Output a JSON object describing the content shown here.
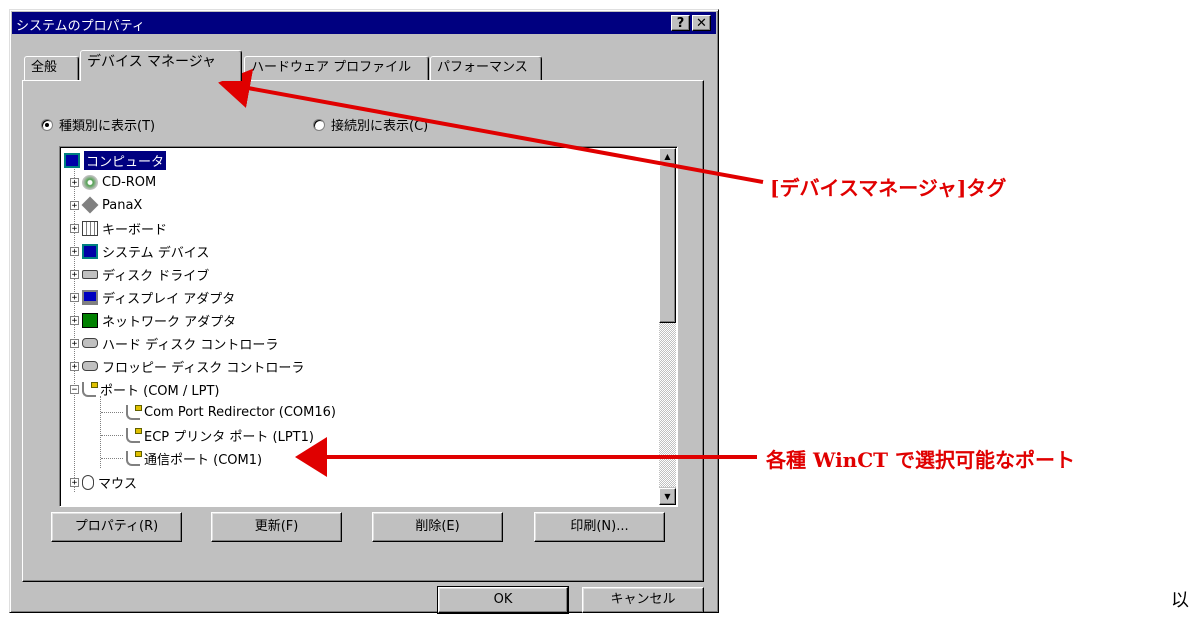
{
  "window": {
    "title": "システムのプロパティ",
    "help_label": "?",
    "close_label": "✕"
  },
  "tabs": [
    "全般",
    "デバイス マネージャ",
    "ハードウェア プロファイル",
    "パフォーマンス"
  ],
  "active_tab": "デバイス マネージャ",
  "view_options": {
    "by_type": "種類別に表示(T)",
    "by_connection": "接続別に表示(C)",
    "selected": "by_type"
  },
  "tree": {
    "root": "コンピュータ",
    "items": [
      {
        "label": "CD-ROM",
        "icon": "cd-icon",
        "expander": "+"
      },
      {
        "label": "PanaX",
        "icon": "diamond-icon",
        "expander": "+"
      },
      {
        "label": "キーボード",
        "icon": "keyboard-icon",
        "expander": "+"
      },
      {
        "label": "システム デバイス",
        "icon": "computer-icon",
        "expander": "+"
      },
      {
        "label": "ディスク ドライブ",
        "icon": "disk-drive-icon",
        "expander": "+"
      },
      {
        "label": "ディスプレイ アダプタ",
        "icon": "monitor-icon",
        "expander": "+"
      },
      {
        "label": "ネットワーク アダプタ",
        "icon": "network-card-icon",
        "expander": "+"
      },
      {
        "label": "ハード ディスク コントローラ",
        "icon": "hdd-controller-icon",
        "expander": "+"
      },
      {
        "label": "フロッピー ディスク コントローラ",
        "icon": "floppy-controller-icon",
        "expander": "+"
      },
      {
        "label": "ポート (COM / LPT)",
        "icon": "port-icon",
        "expander": "−"
      }
    ],
    "ports": [
      "Com Port Redirector (COM16)",
      "ECP プリンタ ポート (LPT1)",
      "通信ポート (COM1)"
    ],
    "last": {
      "label": "マウス",
      "icon": "mouse-icon",
      "expander": "+"
    }
  },
  "buttons": {
    "properties": "プロパティ(R)",
    "refresh": "更新(F)",
    "remove": "削除(E)",
    "print": "印刷(N)...",
    "ok": "OK",
    "cancel": "キャンセル"
  },
  "annotations": {
    "tab_callout": "[デバイスマネージャ]タグ",
    "port_callout": "各種 WinCT で選択可能なポート",
    "corner_text": "以"
  },
  "colors": {
    "annotation": "#e00000",
    "title_bar": "#000080",
    "window_face": "#c0c0c0"
  }
}
